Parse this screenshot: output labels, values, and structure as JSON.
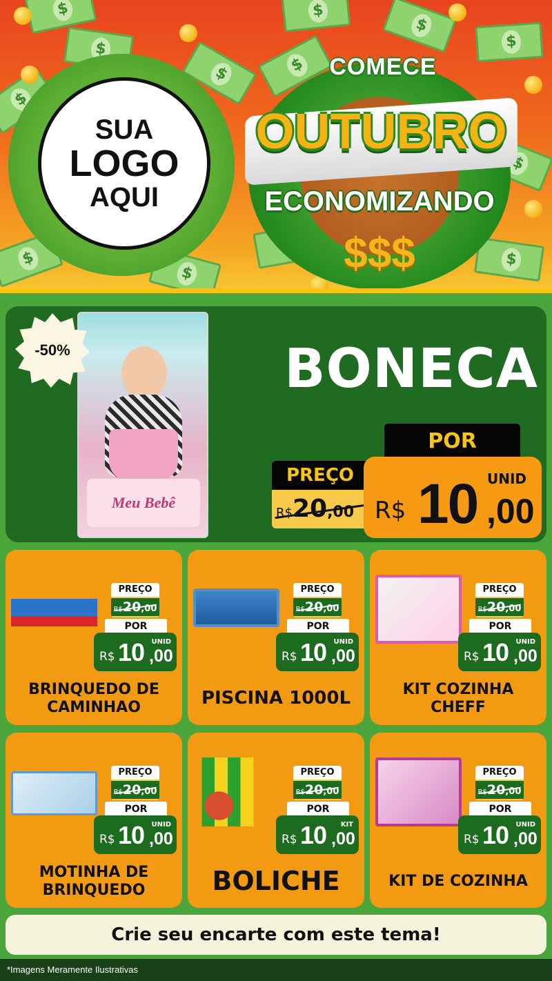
{
  "header": {
    "logo": {
      "line1": "SUA",
      "line2": "LOGO",
      "line3": "AQUI"
    },
    "promo": {
      "top": "COMECE",
      "main": "OUTUBRO",
      "sub": "ECONOMIZANDO",
      "money": "$$$"
    }
  },
  "hero": {
    "discount": "-50%",
    "title": "BONECA",
    "box_label": "Meu Bebê",
    "por_label": "POR",
    "preco_label": "PREÇO",
    "old_price": {
      "currency": "R$",
      "int": "20",
      "cents": ",00"
    },
    "new_price": {
      "currency": "R$",
      "int": "10",
      "cents": ",00",
      "unit": "UNID"
    }
  },
  "products": [
    {
      "name": "BRINQUEDO DE CAMINHAO",
      "art": "trucks-icon",
      "preco_label": "PREÇO",
      "old_price": {
        "currency": "R$",
        "int": "20",
        "cents": ",00"
      },
      "por_label": "POR",
      "new_price": {
        "currency": "R$",
        "int": "10",
        "cents": ",00",
        "unit": "UNID"
      }
    },
    {
      "name": "PISCINA 1000L",
      "art": "pool-icon",
      "preco_label": "PREÇO",
      "old_price": {
        "currency": "R$",
        "int": "20",
        "cents": ",00"
      },
      "por_label": "POR",
      "new_price": {
        "currency": "R$",
        "int": "10",
        "cents": ",00",
        "unit": "UNID"
      }
    },
    {
      "name": "KIT COZINHA CHEFF",
      "art": "kitchen-kit-icon",
      "preco_label": "PREÇO",
      "old_price": {
        "currency": "R$",
        "int": "20",
        "cents": ",00"
      },
      "por_label": "POR",
      "new_price": {
        "currency": "R$",
        "int": "10",
        "cents": ",00",
        "unit": "UNID"
      }
    },
    {
      "name": "MOTINHA DE BRINQUEDO",
      "art": "motorbike-icon",
      "preco_label": "PREÇO",
      "old_price": {
        "currency": "R$",
        "int": "20",
        "cents": ",00"
      },
      "por_label": "POR",
      "new_price": {
        "currency": "R$",
        "int": "10",
        "cents": ",00",
        "unit": "UNID"
      }
    },
    {
      "name": "BOLICHE",
      "art": "bowling-icon",
      "preco_label": "PREÇO",
      "old_price": {
        "currency": "R$",
        "int": "20",
        "cents": ",00"
      },
      "por_label": "POR",
      "new_price": {
        "currency": "R$",
        "int": "10",
        "cents": ",00",
        "unit": "KIT"
      }
    },
    {
      "name": "KIT DE COZINHA",
      "art": "kitchen-set-icon",
      "preco_label": "PREÇO",
      "old_price": {
        "currency": "R$",
        "int": "20",
        "cents": ",00"
      },
      "por_label": "POR",
      "new_price": {
        "currency": "R$",
        "int": "10",
        "cents": ",00",
        "unit": "UNID"
      }
    }
  ],
  "cta": {
    "text": "Crie seu encarte com este tema!"
  },
  "footer": {
    "disclaimer": "*Imagens Meramente Ilustrativas"
  },
  "colors": {
    "header_top": "#e8441f",
    "header_bottom": "#f7c830",
    "hero_bg": "#1f6b22",
    "card_bg": "#f29a12",
    "price_green": "#1d6b1f",
    "accent_yellow": "#f7c314",
    "page_green": "#4aa63a"
  }
}
